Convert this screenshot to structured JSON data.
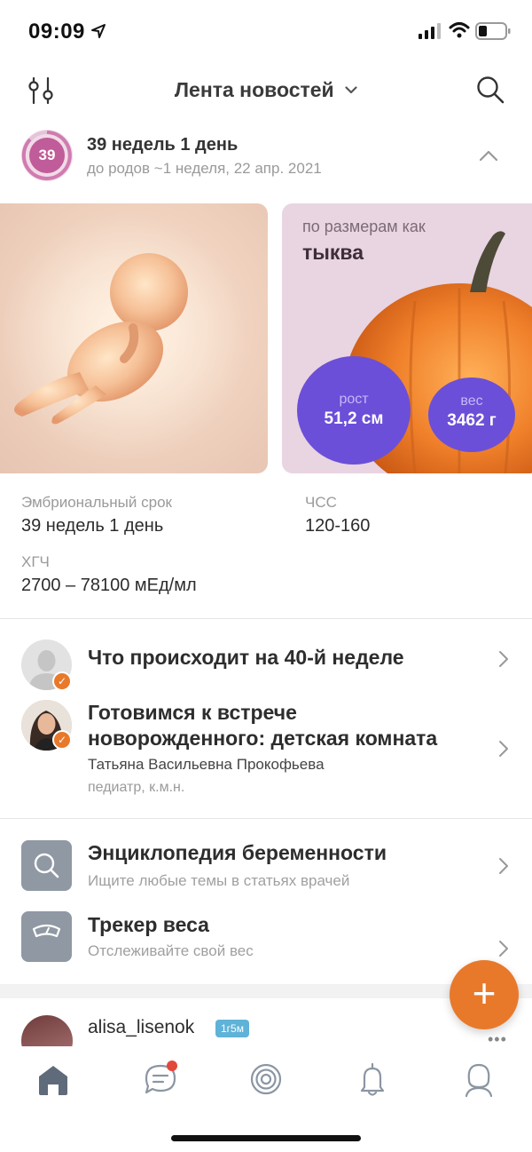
{
  "status_bar": {
    "time": "09:09"
  },
  "header": {
    "title": "Лента новостей"
  },
  "week": {
    "badge": "39",
    "title": "39 недель 1 день",
    "subtitle": "до родов ~1 неделя, 22 апр. 2021"
  },
  "size_card": {
    "caption": "по размерам как",
    "name": "тыква",
    "height_label": "рост",
    "height_value": "51,2 см",
    "weight_label": "вес",
    "weight_value": "3462 г"
  },
  "info": {
    "embryo_label": "Эмбриональный срок",
    "embryo_value": "39 недель 1 день",
    "hr_label": "ЧСС",
    "hr_value": "120-160",
    "hcg_label": "ХГЧ",
    "hcg_value": "2700 – 78100  мЕд/мл"
  },
  "articles": [
    {
      "title": "Что происходит на 40-й неделе"
    },
    {
      "title_line1": "Готовимся к встрече",
      "title_line2": "новорожденного: детская комната",
      "author": "Татьяна Васильевна Прокофьева",
      "role": "педиатр, к.м.н."
    }
  ],
  "tools": [
    {
      "title": "Энциклопедия беременности",
      "subtitle": "Ищите любые темы в статьях врачей",
      "icon": "search-icon"
    },
    {
      "title": "Трекер веса",
      "subtitle": "Отслеживайте свой вес",
      "icon": "scale-icon"
    }
  ],
  "feed": {
    "username": "alisa_lisenok",
    "badge": "1г5м"
  },
  "fab": {
    "label": "+"
  },
  "tabbar": {
    "items": [
      "home-icon",
      "chat-icon",
      "target-icon",
      "bell-icon",
      "profile-icon"
    ],
    "accent": "#e8792b"
  },
  "colors": {
    "accent": "#e8792b",
    "purple": "#6b4fd8",
    "badge": "#c05c99"
  }
}
